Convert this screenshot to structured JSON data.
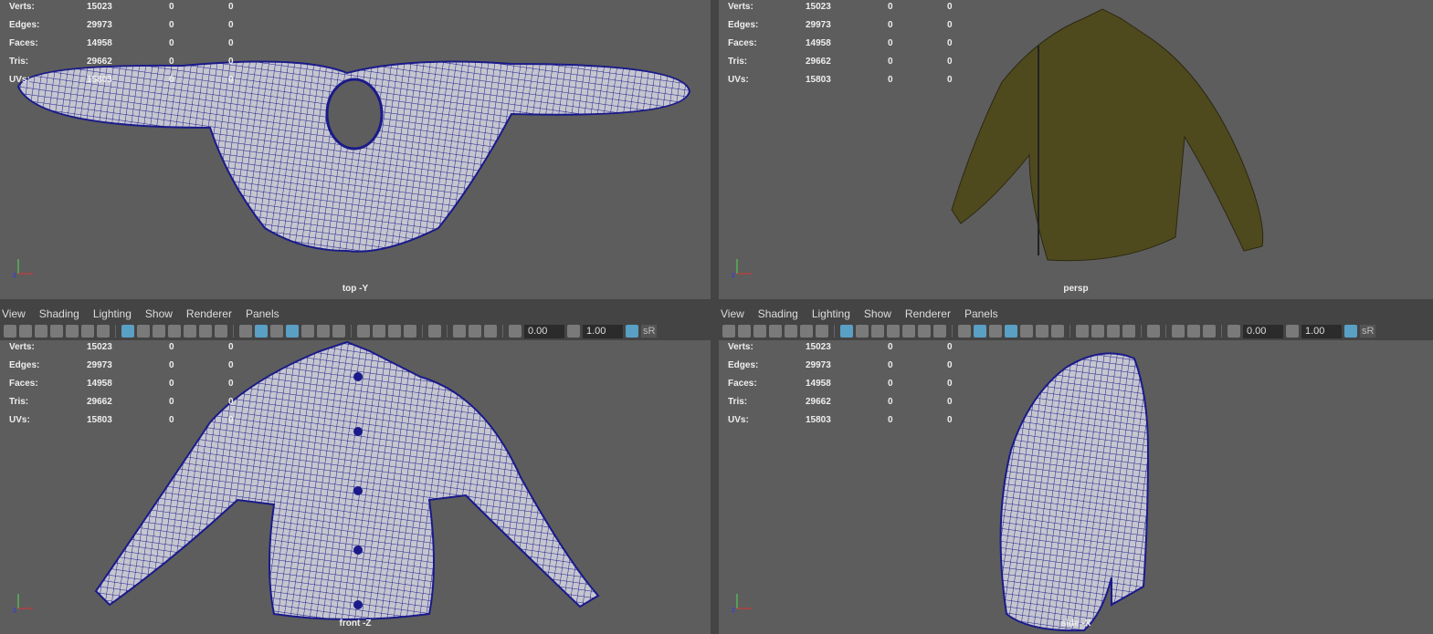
{
  "menu": [
    "View",
    "Shading",
    "Lighting",
    "Show",
    "Renderer",
    "Panels"
  ],
  "stats": {
    "labels": [
      "Verts:",
      "Edges:",
      "Faces:",
      "Tris:",
      "UVs:"
    ],
    "values": [
      "15023",
      "29973",
      "14958",
      "29662",
      "15803"
    ],
    "zero": "0"
  },
  "toolbar": {
    "field1": "0.00",
    "field2": "1.00",
    "srgb": "sR",
    "icons": [
      "camera-icon",
      "camera-lock-icon",
      "camera-attr-icon",
      "bookmark-icon",
      "grid-pen-icon",
      "snapshot-icon",
      "pencil-icon",
      "|",
      "grid-icon",
      "film-gate-icon",
      "resolution-gate-icon",
      "gate-mask-icon",
      "field-chart-icon",
      "safe-action-icon",
      "safe-title-icon",
      "|",
      "wireframe-icon",
      "smooth-shade-icon",
      "shade-default-icon",
      "wireframe-on-shaded-icon",
      "textured-icon",
      "lights-icon",
      "shadows-icon",
      "|",
      "ambient-occlusion-icon",
      "motion-blur-icon",
      "anti-alias-icon",
      "dof-icon",
      "|",
      "isolate-select-icon",
      "|",
      "xray-icon",
      "xray-joints-icon",
      "backface-icon",
      "|",
      "exposure-icon",
      "field",
      "gamma-icon",
      "field2",
      "color-mgmt-icon",
      "srgb"
    ],
    "active": [
      "grid-icon",
      "smooth-shade-icon",
      "wireframe-on-shaded-icon",
      "color-mgmt-icon"
    ]
  },
  "viewports": [
    {
      "camera": "top -Y"
    },
    {
      "camera": "persp"
    },
    {
      "camera": "front -Z"
    },
    {
      "camera": "side -X"
    }
  ],
  "colors": {
    "mesh": "#1a1a8a",
    "meshfill": "#c8c8d0",
    "jacket": "#4f4a1e"
  }
}
